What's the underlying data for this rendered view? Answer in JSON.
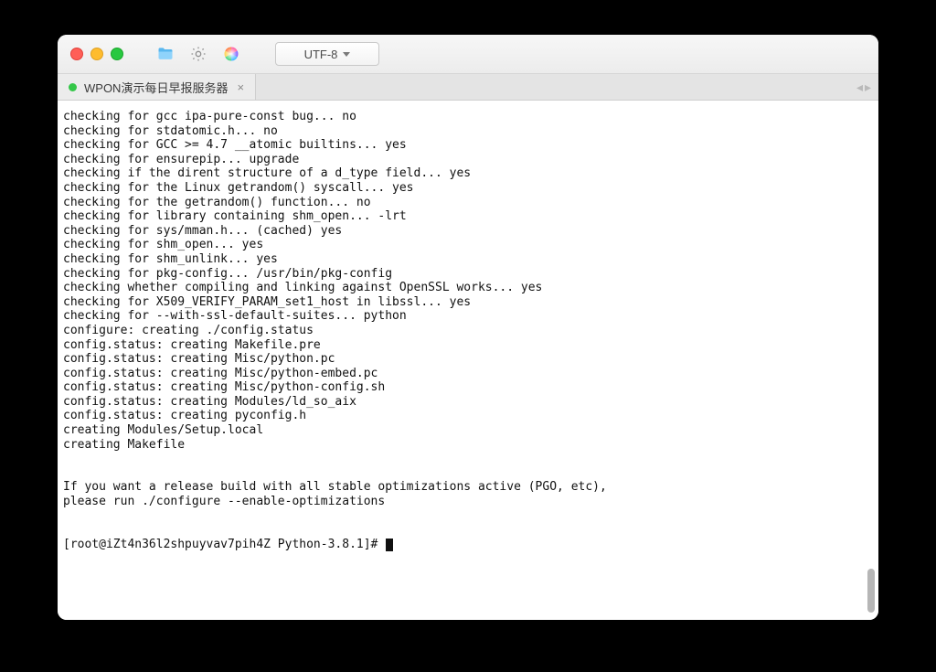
{
  "titlebar": {
    "encoding_label": "UTF-8"
  },
  "tab": {
    "title": "WPON演示每日早报服务器"
  },
  "terminal": {
    "lines": [
      "checking for gcc ipa-pure-const bug... no",
      "checking for stdatomic.h... no",
      "checking for GCC >= 4.7 __atomic builtins... yes",
      "checking for ensurepip... upgrade",
      "checking if the dirent structure of a d_type field... yes",
      "checking for the Linux getrandom() syscall... yes",
      "checking for the getrandom() function... no",
      "checking for library containing shm_open... -lrt",
      "checking for sys/mman.h... (cached) yes",
      "checking for shm_open... yes",
      "checking for shm_unlink... yes",
      "checking for pkg-config... /usr/bin/pkg-config",
      "checking whether compiling and linking against OpenSSL works... yes",
      "checking for X509_VERIFY_PARAM_set1_host in libssl... yes",
      "checking for --with-ssl-default-suites... python",
      "configure: creating ./config.status",
      "config.status: creating Makefile.pre",
      "config.status: creating Misc/python.pc",
      "config.status: creating Misc/python-embed.pc",
      "config.status: creating Misc/python-config.sh",
      "config.status: creating Modules/ld_so_aix",
      "config.status: creating pyconfig.h",
      "creating Modules/Setup.local",
      "creating Makefile",
      "",
      "",
      "If you want a release build with all stable optimizations active (PGO, etc),",
      "please run ./configure --enable-optimizations",
      "",
      "",
      "[root@iZt4n36l2shpuyvav7pih4Z Python-3.8.1]# "
    ]
  }
}
